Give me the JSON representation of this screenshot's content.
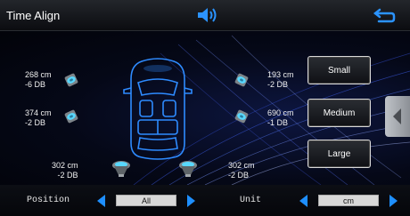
{
  "header": {
    "title": "Time Align",
    "volume_icon": "speaker-volume-icon",
    "back_icon": "return-arrow-icon"
  },
  "speakers": {
    "front_left": {
      "distance": "268 cm",
      "level": "-6 DB"
    },
    "front_right": {
      "distance": "193 cm",
      "level": "-2 DB"
    },
    "rear_left": {
      "distance": "374 cm",
      "level": "-2 DB"
    },
    "rear_right": {
      "distance": "690 cm",
      "level": "-1 DB"
    },
    "sub_left": {
      "distance": "302 cm",
      "level": "-2 DB"
    },
    "sub_right": {
      "distance": "302 cm",
      "level": "-2 DB"
    }
  },
  "size_buttons": {
    "small": "Small",
    "medium": "Medium",
    "large": "Large"
  },
  "footer": {
    "position_label": "Position",
    "position_value": "All",
    "unit_label": "Unit",
    "unit_value": "cm"
  },
  "colors": {
    "accent": "#1e8fff",
    "background": "#05060a"
  }
}
